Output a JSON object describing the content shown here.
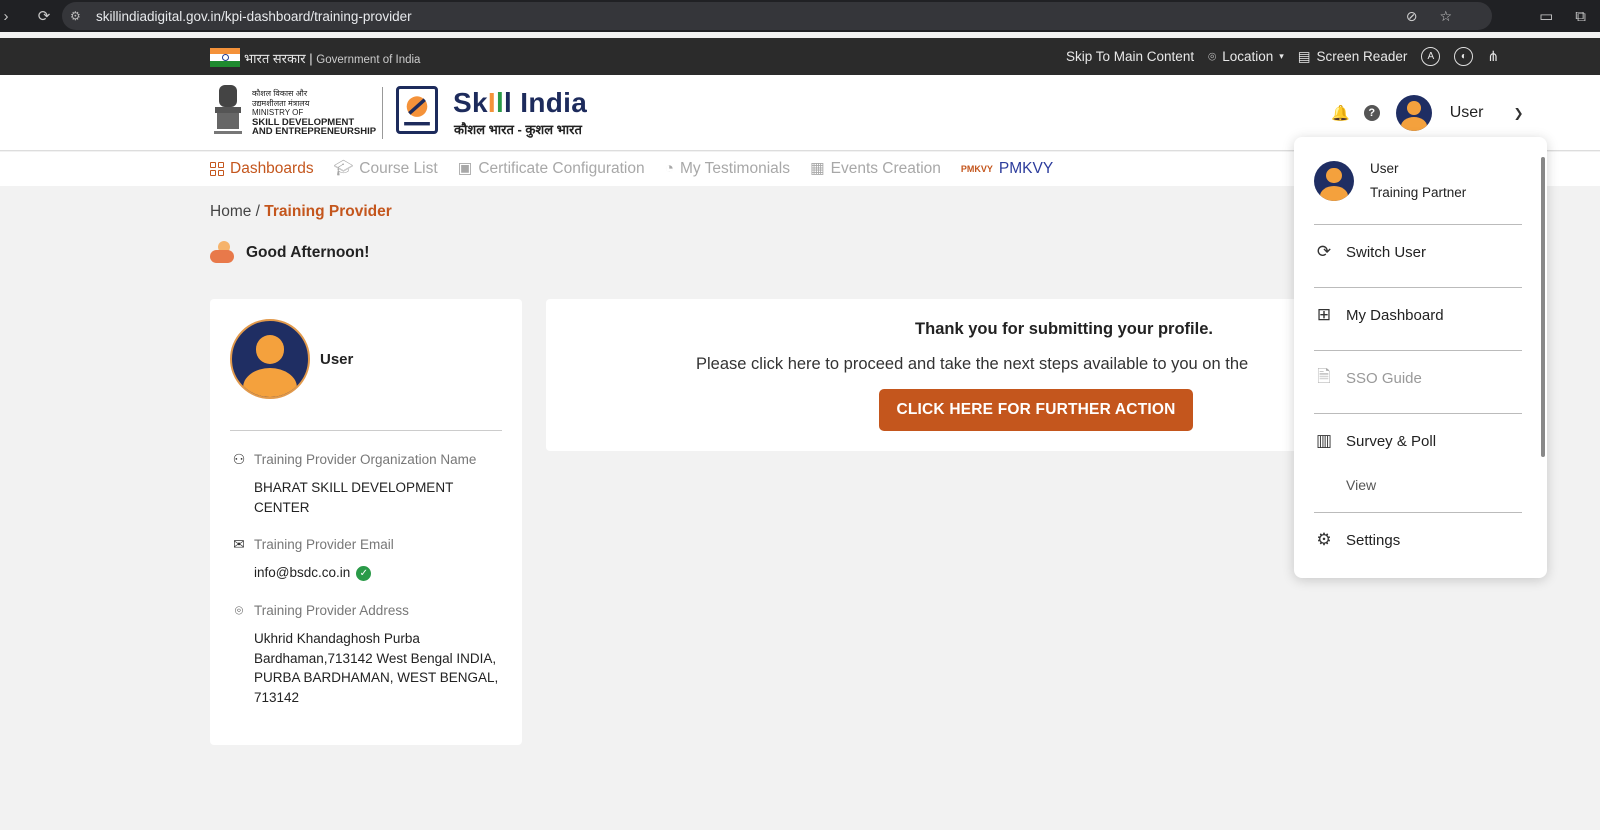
{
  "browser": {
    "url": "skillindiadigital.gov.in/kpi-dashboard/training-provider",
    "back_icon": "arrow-right-icon",
    "reload_icon": "reload-icon"
  },
  "gov_bar": {
    "hindi": "भारत सरकार",
    "english": "Government of India",
    "skip": "Skip To Main Content",
    "location": "Location",
    "screen_reader": "Screen Reader",
    "font_badge": "A"
  },
  "header": {
    "ministry_line1": "कौशल विकास और",
    "ministry_line2": "उद्यमशीलता मंत्रालय",
    "ministry_line3": "MINISTRY OF",
    "ministry_line4": "SKILL DEVELOPMENT",
    "ministry_line5": "AND ENTREPRENEURSHIP",
    "brand_sk": "Sk",
    "brand_rest": "India",
    "tagline": "कौशल भारत - कुशल भारत",
    "user_label": "User"
  },
  "nav": {
    "items": [
      {
        "label": "Dashboards"
      },
      {
        "label": "Course List"
      },
      {
        "label": "Certificate Configuration"
      },
      {
        "label": "My Testimonials"
      },
      {
        "label": "Events Creation"
      },
      {
        "label": "PMKVY"
      }
    ],
    "pm_logo": "PMKVY"
  },
  "breadcrumb": {
    "home": "Home",
    "sep": " / ",
    "current": "Training Provider"
  },
  "greeting": "Good Afternoon!",
  "profile": {
    "name": "User",
    "org_label": "Training Provider Organization Name",
    "org_value": "BHARAT SKILL DEVELOPMENT CENTER",
    "email_label": "Training Provider Email",
    "email_value": "info@bsdc.co.in",
    "address_label": "Training Provider Address",
    "address_value": "Ukhrid Khandaghosh Purba Bardhaman,713142 West Bengal INDIA, PURBA BARDHAMAN, WEST BENGAL, 713142"
  },
  "action": {
    "title": "Thank you for submitting your profile.",
    "text": "Please click here to proceed and take the next steps available to you on the",
    "button": "CLICK HERE FOR FURTHER ACTION"
  },
  "dropdown": {
    "user_name": "User",
    "user_role": "Training Partner",
    "switch_user": "Switch User",
    "my_dashboard": "My Dashboard",
    "sso_guide": "SSO Guide",
    "survey_poll": "Survey & Poll",
    "view": "View",
    "settings": "Settings"
  },
  "colors": {
    "accent": "#c4561d",
    "navy": "#1d2b5c",
    "verified": "#2a9a48"
  }
}
